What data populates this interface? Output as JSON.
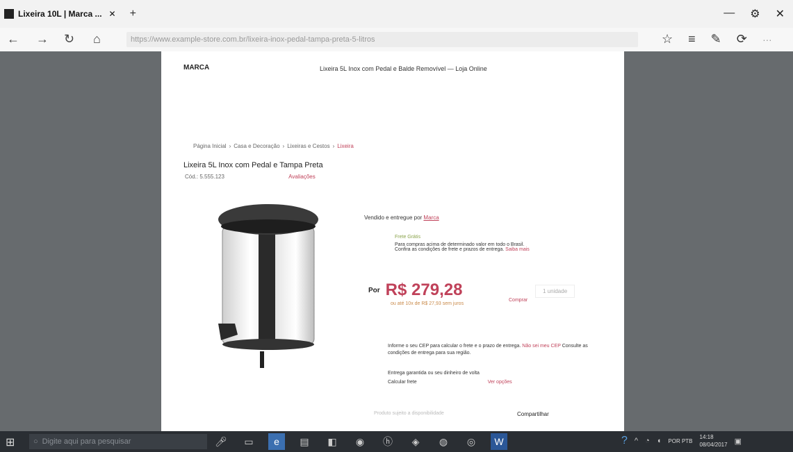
{
  "browser": {
    "tab_title": "Lixeira 10L | Marca ...",
    "tab_close": "✕",
    "new_tab": "+",
    "address_text": "https://www.example-store.com.br/lixeira-inox-pedal-tampa-preta-5-litros",
    "win_buttons": [
      "—",
      "⚙",
      "✕"
    ]
  },
  "page": {
    "logo": "MARCA",
    "top_note": "Lixeira 5L Inox com Pedal e Balde Removível — Loja Online",
    "breadcrumbs": [
      "Página Inicial",
      "Casa e Decoração",
      "Lixeiras e Cestos",
      "Lixeira"
    ],
    "title": "Lixeira 5L Inox com Pedal e Tampa Preta",
    "sub_left": "Cód.: 5.555.123",
    "sub_link": "Avaliações",
    "sold_by": "Vendido e entregue por",
    "sold_by_link": "Marca",
    "badge_tag": "Frete Grátis",
    "badge_text": "Para compras acima de determinado valor em todo o Brasil. Confira as condições de frete e prazos de entrega.",
    "badge_link": "Saiba mais",
    "price_currency": "Por",
    "price": "R$ 279,28",
    "installment": "ou até 10x de R$ 27,93 sem juros",
    "price_right": "Comprar",
    "qty_label": "1 unidade",
    "ship_text": "Informe o seu CEP para calcular o frete e o prazo de entrega.",
    "ship_link": "Não sei meu CEP",
    "ship_text2": "Consulte as condições de entrega para sua região.",
    "delivery_title": "Entrega garantida ou seu dinheiro de volta",
    "delivery_left": "Calcular frete",
    "delivery_link": "Ver opções",
    "foot_grey": "Produto sujeito a disponibilidade",
    "foot_link": "Compartilhar"
  },
  "taskbar": {
    "search_placeholder": "Digite aqui para pesquisar",
    "clock_time": "14:18",
    "clock_date": "08/04/2017",
    "lang": "POR PTB"
  }
}
